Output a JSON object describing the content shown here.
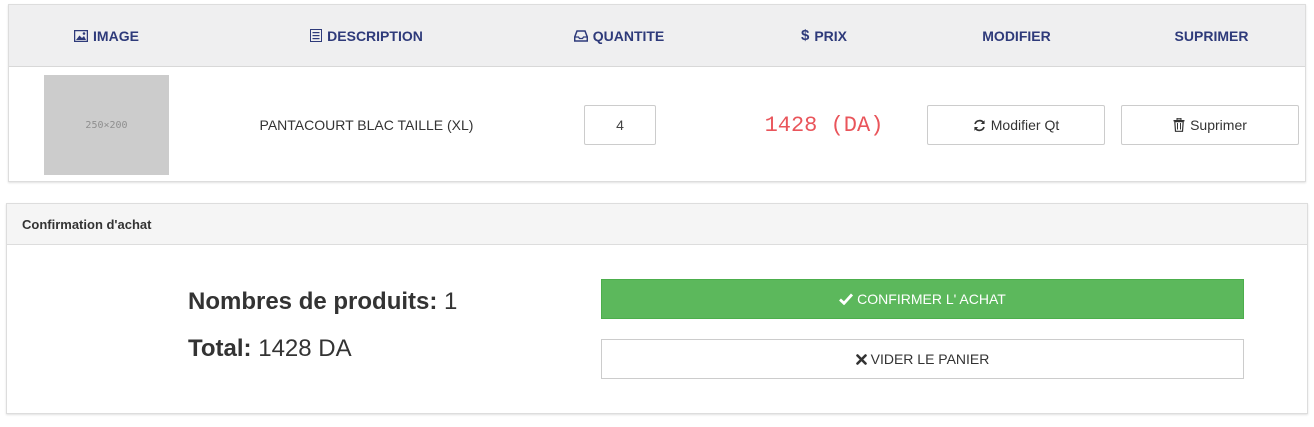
{
  "table": {
    "headers": {
      "image": "IMAGE",
      "description": "DESCRIPTION",
      "quantity": "QUANTITE",
      "price": "PRIX",
      "price_symbol": "$",
      "modify": "MODIFIER",
      "delete": "SUPRIMER"
    },
    "rows": [
      {
        "thumbnail_text": "250×200",
        "description": "PANTACOURT BLAC TAILLE (XL)",
        "quantity": "4",
        "price": "1428 (DA)",
        "modify_label": "Modifier Qt",
        "delete_label": "Suprimer"
      }
    ]
  },
  "confirmation": {
    "title": "Confirmation d'achat",
    "products_label": "Nombres de produits:",
    "products_value": "1",
    "total_label": "Total:",
    "total_value": "1428 DA",
    "confirm_label": "CONFIRMER L' ACHAT",
    "empty_label": "VIDER LE PANIER"
  },
  "colors": {
    "header_text": "#2e3a7a",
    "price": "#e9555b",
    "confirm_button": "#5cb85c"
  },
  "icons": {
    "image": "picture-icon",
    "description": "list-icon",
    "quantity": "inbox-icon",
    "modify": "refresh-icon",
    "delete": "trash-icon",
    "confirm": "checkmark-icon",
    "empty": "close-icon"
  }
}
